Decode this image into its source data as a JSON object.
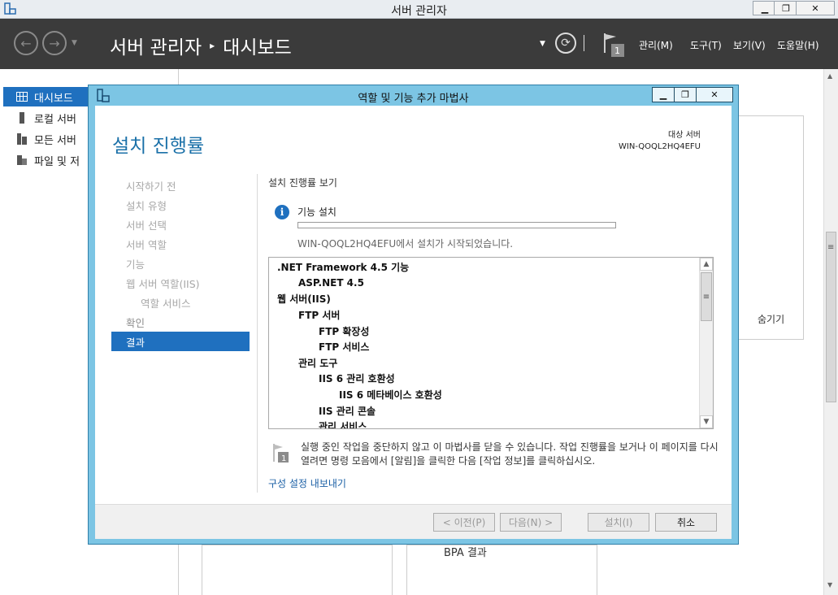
{
  "window": {
    "title": "서버 관리자",
    "minimize": "▁",
    "maximize": "❐",
    "close": "✕"
  },
  "header": {
    "breadcrumb_root": "서버 관리자",
    "breadcrumb_sep": "▸",
    "breadcrumb_page": "대시보드",
    "flag_count": "1",
    "menu": [
      "관리(M)",
      "도구(T)",
      "보기(V)",
      "도움말(H)"
    ]
  },
  "sidebar": {
    "items": [
      {
        "label": "대시보드"
      },
      {
        "label": "로컬 서버"
      },
      {
        "label": "모든 서버"
      },
      {
        "label": "파일 및 저"
      }
    ]
  },
  "background": {
    "hide_label": "숨기기",
    "bpa_label": "BPA 결과"
  },
  "wizard": {
    "title": "역할 및 기능 추가 마법사",
    "heading": "설치 진행률",
    "target_caption": "대상 서버",
    "target_server": "WIN-QOQL2HQ4EFU",
    "steps": [
      {
        "label": "시작하기 전"
      },
      {
        "label": "설치 유형"
      },
      {
        "label": "서버 선택"
      },
      {
        "label": "서버 역할"
      },
      {
        "label": "기능"
      },
      {
        "label": "웹 서버 역할(IIS)"
      },
      {
        "label": "역할 서비스"
      },
      {
        "label": "확인"
      },
      {
        "label": "결과"
      }
    ],
    "section_title": "설치 진행률 보기",
    "feature_label": "기능 설치",
    "progress": 0,
    "status_text": "WIN-QOQL2HQ4EFU에서 설치가 시작되었습니다.",
    "list_items": [
      ".NET Framework 4.5 기능",
      "ASP.NET 4.5",
      "웹 서버(IIS)",
      "FTP 서버",
      "FTP 확장성",
      "FTP 서비스",
      "관리 도구",
      "IIS 6 관리 호환성",
      "IIS 6 메타베이스 호환성",
      "IIS 관리 콘솔",
      "관리 서비스"
    ],
    "notice_flag_count": "1",
    "notice_text": "실행 중인 작업을 중단하지 않고 이 마법사를 닫을 수 있습니다. 작업 진행률을 보거나 이 페이지를 다시 열려면 명령 모음에서 [알림]을 클릭한 다음 [작업 정보]를 클릭하십시오.",
    "export_link": "구성 설정 내보내기",
    "buttons": {
      "prev": "< 이전(P)",
      "next": "다음(N) >",
      "install": "설치(I)",
      "cancel": "취소"
    }
  }
}
